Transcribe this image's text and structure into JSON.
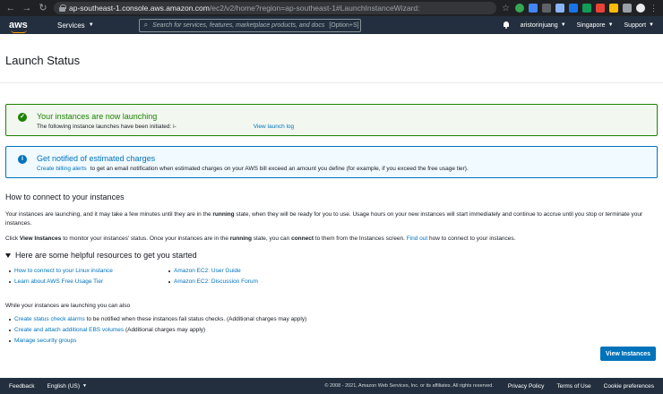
{
  "browser": {
    "url_host": "ap-southeast-1.console.aws.amazon.com",
    "url_path": "/ec2/v2/home?region=ap-southeast-1#LaunchInstanceWizard:",
    "badge": "3.56"
  },
  "topnav": {
    "logo": "aws",
    "services": "Services",
    "search_placeholder": "Search for services, features, marketplace products, and docs",
    "search_shortcut": "[Option+S]",
    "user": "aristorinjuang",
    "region": "Singapore",
    "support": "Support"
  },
  "page": {
    "title": "Launch Status"
  },
  "success_alert": {
    "title": "Your instances are now launching",
    "body": "The following instance launches have been initiated: i-",
    "link": "View launch log"
  },
  "info_alert": {
    "title": "Get notified of estimated charges",
    "link": "Create billing alerts",
    "body": "to get an email notification when estimated charges on your AWS bill exceed an amount you define (for example, if you exceed the free usage tier)."
  },
  "connect": {
    "heading": "How to connect to your instances",
    "p1_a": "Your instances are launching, and it may take a few minutes until they are in the ",
    "p1_b": "running",
    "p1_c": " state, when they will be ready for you to use. Usage hours on your new instances will start immediately and continue to accrue until you stop or terminate your instances.",
    "p2_a": "Click ",
    "p2_b": "View Instances",
    "p2_c": " to monitor your instances' status. Once your instances are in the ",
    "p2_d": "running",
    "p2_e": " state, you can ",
    "p2_f": "connect",
    "p2_g": " to them from the Instances screen. ",
    "p2_link": "Find out",
    "p2_h": " how to connect to your instances."
  },
  "resources": {
    "heading": "Here are some helpful resources to get you started",
    "col1": [
      "How to connect to your Linux instance",
      "Learn about AWS Free Usage Tier"
    ],
    "col2": [
      "Amazon EC2: User Guide",
      "Amazon EC2: Discussion Forum"
    ]
  },
  "while": {
    "heading": "While your instances are launching you can also",
    "items": [
      {
        "link": "Create status check alarms",
        "text": " to be notified when these instances fail status checks. (Additional charges may apply)"
      },
      {
        "link": "Create and attach additional EBS volumes",
        "text": " (Additional charges may apply)"
      },
      {
        "link": "Manage security groups",
        "text": ""
      }
    ]
  },
  "view_instances_button": "View Instances",
  "footer": {
    "feedback": "Feedback",
    "language": "English (US)",
    "copyright": "© 2008 - 2021, Amazon Web Services, Inc. or its affiliates. All rights reserved.",
    "privacy": "Privacy Policy",
    "terms": "Terms of Use",
    "cookies": "Cookie preferences"
  },
  "colors": {
    "aws_nav": "#232f3e",
    "success": "#1d8102",
    "info": "#0073bb",
    "link": "#0073bb",
    "accent": "#ff9900"
  }
}
